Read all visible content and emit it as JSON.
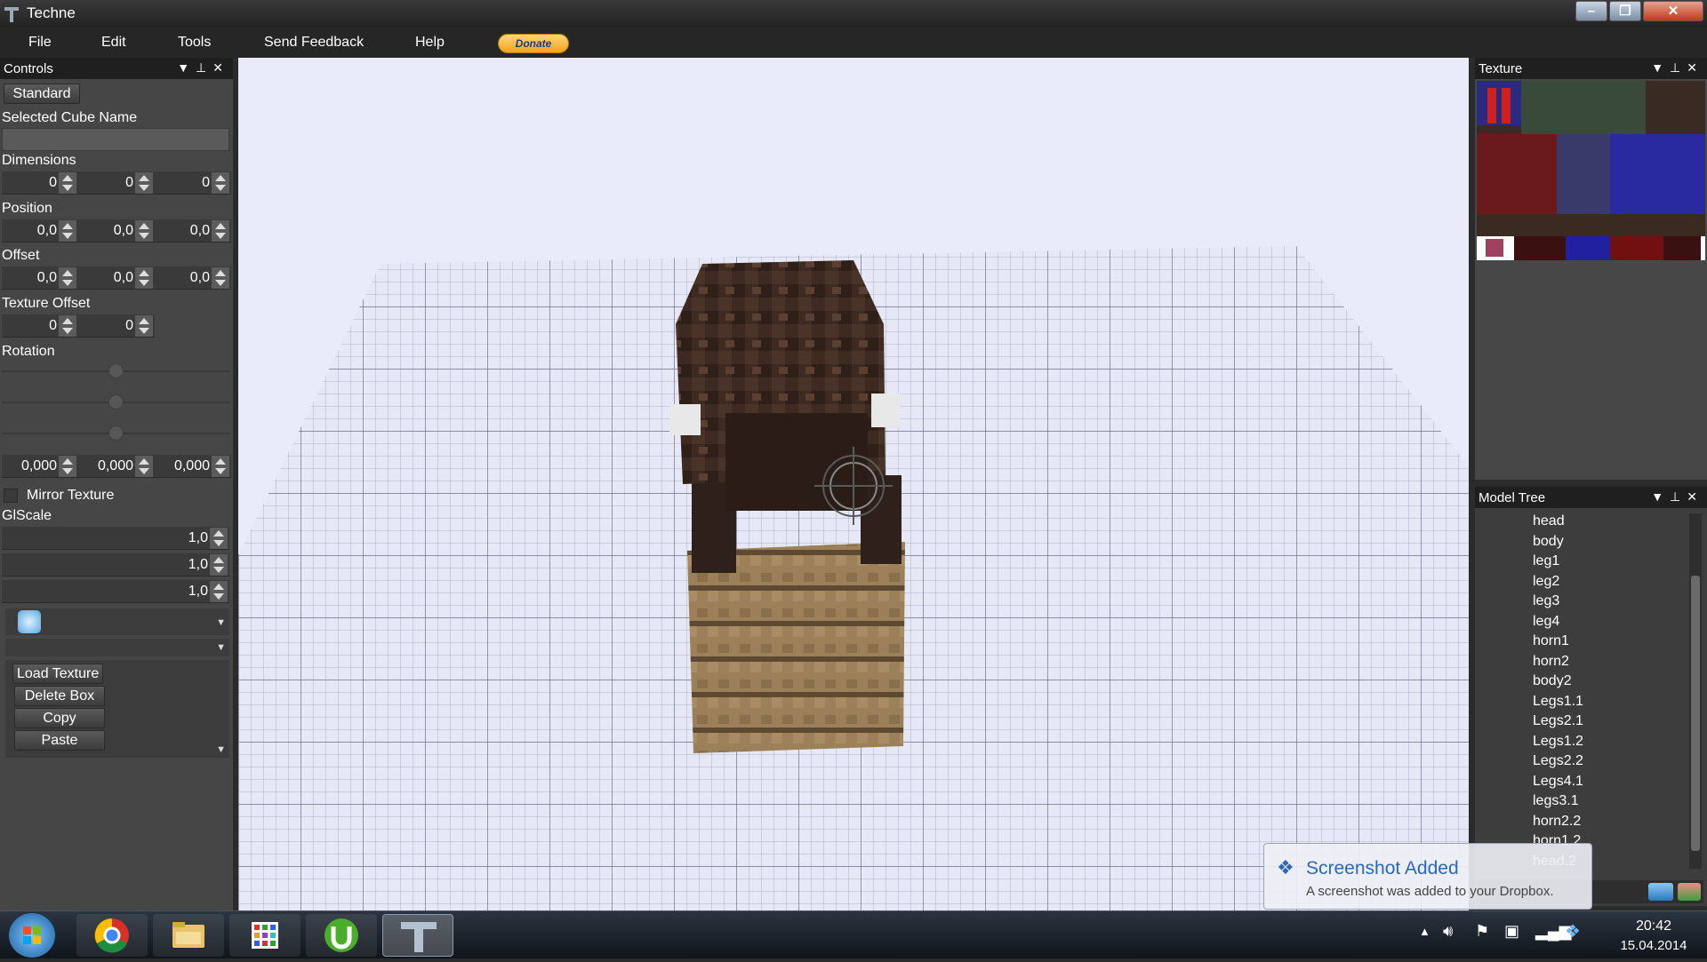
{
  "window": {
    "title": "Techne"
  },
  "menu": {
    "items": [
      "File",
      "Edit",
      "Tools",
      "Send Feedback",
      "Help"
    ],
    "donate_label": "Donate"
  },
  "controls": {
    "title": "Controls",
    "standard_label": "Standard",
    "selected_cube_name_label": "Selected Cube Name",
    "selected_cube_name_value": "",
    "dimensions_label": "Dimensions",
    "dimensions": [
      "0",
      "0",
      "0"
    ],
    "position_label": "Position",
    "position": [
      "0,0",
      "0,0",
      "0,0"
    ],
    "offset_label": "Offset",
    "offset": [
      "0,0",
      "0,0",
      "0,0"
    ],
    "texture_offset_label": "Texture Offset",
    "texture_offset": [
      "0",
      "0"
    ],
    "rotation_label": "Rotation",
    "rotation_sliders": [
      0.5,
      0.5,
      0.5
    ],
    "rotation": [
      "0,000",
      "0,000",
      "0,000"
    ],
    "mirror_texture_label": "Mirror Texture",
    "glscale_label": "GlScale",
    "glscale": [
      "1,0",
      "1,0",
      "1,0"
    ],
    "buttons": {
      "load_texture": "Load Texture",
      "delete_box": "Delete Box",
      "copy": "Copy",
      "paste": "Paste"
    }
  },
  "texture_panel": {
    "title": "Texture"
  },
  "model_tree": {
    "title": "Model Tree",
    "items": [
      "head",
      "body",
      "leg1",
      "leg2",
      "leg3",
      "leg4",
      "horn1",
      "horn2",
      "body2",
      "Legs1.1",
      "Legs2.1",
      "Legs1.2",
      "Legs2.2",
      "Legs4.1",
      "legs3.1",
      "horn2.2",
      "horn1.2",
      "head.2"
    ]
  },
  "notification": {
    "title": "Screenshot Added",
    "body": "A screenshot was added to your Dropbox."
  },
  "taskbar": {
    "time": "20:42",
    "date": "15.04.2014"
  },
  "colors": {
    "panel_bg": "#464646",
    "header_bg": "#1f1f1f",
    "viewport_bg": "#e9ecf8",
    "donate": "#f2a21e"
  }
}
